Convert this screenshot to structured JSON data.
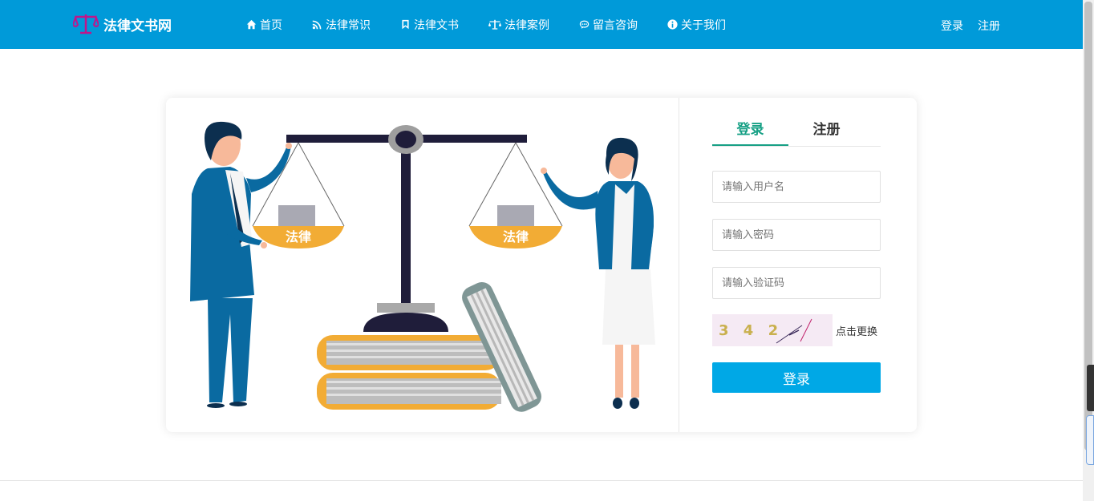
{
  "brand": {
    "name": "法律文书网",
    "logo_color": "#c0158a"
  },
  "nav": [
    {
      "icon": "home-icon",
      "label": "首页"
    },
    {
      "icon": "rss-icon",
      "label": "法律常识"
    },
    {
      "icon": "bookmark-icon",
      "label": "法律文书"
    },
    {
      "icon": "scale-icon",
      "label": "法律案例"
    },
    {
      "icon": "chat-icon",
      "label": "留言咨询"
    },
    {
      "icon": "info-icon",
      "label": "关于我们"
    }
  ],
  "header_auth": {
    "login": "登录",
    "register": "注册"
  },
  "illustration": {
    "pan_label_left": "法律",
    "pan_label_right": "法律"
  },
  "form": {
    "tabs": [
      {
        "label": "登录",
        "active": true
      },
      {
        "label": "注册",
        "active": false
      }
    ],
    "username_placeholder": "请输入用户名",
    "password_placeholder": "请输入密码",
    "captcha_placeholder": "请输入验证码",
    "captcha_text": "3 4 2",
    "captcha_refresh": "点击更换",
    "submit_label": "登录"
  },
  "colors": {
    "header_bg": "#009ad9",
    "accent": "#17a085",
    "button": "#00a8e6"
  }
}
